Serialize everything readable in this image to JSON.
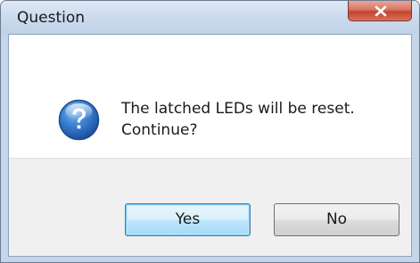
{
  "window": {
    "title": "Question"
  },
  "titlebar": {
    "close_icon": "close-icon"
  },
  "dialog": {
    "icon": "question-icon",
    "message_line1": "The latched LEDs will be reset.",
    "message_line2": "Continue?"
  },
  "buttons": {
    "yes_label": "Yes",
    "no_label": "No"
  },
  "colors": {
    "titlebar": "#c5d6ea",
    "close_button": "#c4452e",
    "question_icon": "#2d6cc0",
    "footer": "#f0f0f0",
    "default_button_border": "#3c7fb1"
  }
}
